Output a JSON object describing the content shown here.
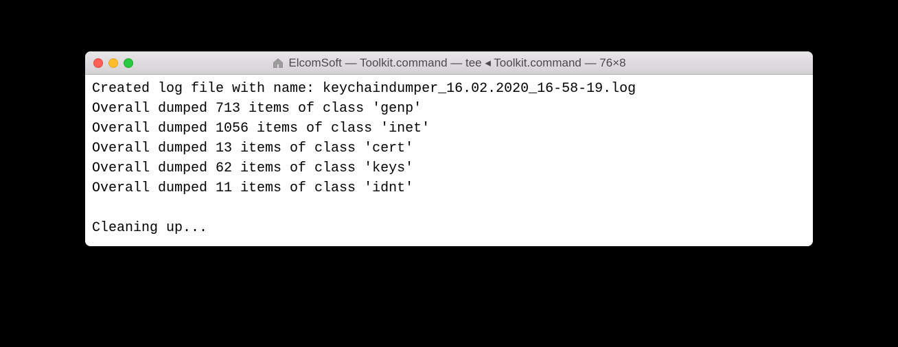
{
  "window": {
    "title": "ElcomSoft — Toolkit.command — tee ◂ Toolkit.command — 76×8"
  },
  "terminal": {
    "lines": [
      "Created log file with name: keychaindumper_16.02.2020_16-58-19.log",
      "Overall dumped 713 items of class 'genp'",
      "Overall dumped 1056 items of class 'inet'",
      "Overall dumped 13 items of class 'cert'",
      "Overall dumped 62 items of class 'keys'",
      "Overall dumped 11 items of class 'idnt'",
      "",
      "Cleaning up..."
    ]
  }
}
